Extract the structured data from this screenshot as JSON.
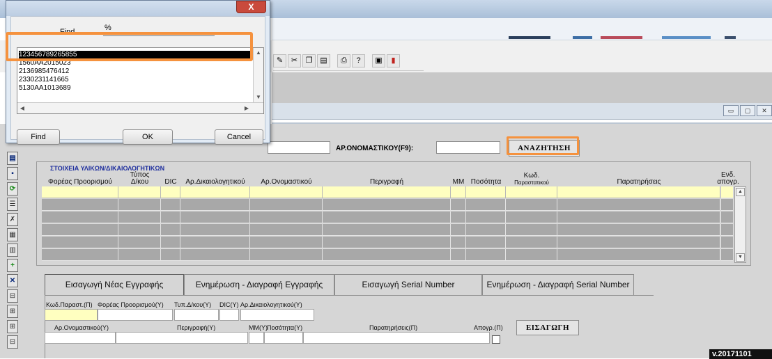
{
  "app": {
    "window_title": "",
    "version": "v.20171101"
  },
  "search": {
    "left_value": "",
    "label": "ΑΡ.ΟΝΟΜΑΣΤΙΚΟΥ(F9):",
    "value": "",
    "button_label": "ΑΝΑΖΗΤΗΣΗ"
  },
  "grid": {
    "section_title": "ΣΤΟΙΧΕΙΑ ΥΛΙΚΩΝ/ΔΙΚΑΙΟΛΟΓΗΤΙΚΩΝ",
    "columns": {
      "carrier": "Φορέας Προορισμού",
      "type_line1": "Τύπος",
      "type_line2": "Δ/κου",
      "dic": "DIC",
      "voucher_no": "Αρ.Δικαιολογητικού",
      "nominal_no": "Αρ.Ονομαστικού",
      "description": "Περιγραφή",
      "mm": "ΜΜ",
      "quantity": "Ποσότητα",
      "code_line1": "Κωδ.",
      "code_line2": "Παραστατικού",
      "notes": "Παρατηρήσεις",
      "archive_line1": "Ενδ.",
      "archive_line2": "απογρ."
    }
  },
  "tabs": [
    {
      "label": "Εισαγωγή Νέας Εγγραφής",
      "active": true
    },
    {
      "label": "Ενημέρωση - Διαγραφή Εγγραφής",
      "active": false
    },
    {
      "label": "Εισαγωγή Serial Number",
      "active": false
    },
    {
      "label": "Ενημέρωση - Διαγραφή Serial Number",
      "active": false
    }
  ],
  "new_record_form": {
    "code_label": "Κωδ.Παραστ.(Π)",
    "carrier_label": "Φορέας Προορισμού(Υ)",
    "type_label": "Τυπ.Δ/κου(Υ)",
    "dic_label": "DIC(Υ)",
    "voucher_label": "Αρ.Δικαιολογητικού(Υ)",
    "nominal_label": "Αρ.Ονομαστικού(Υ)",
    "description_label": "Περιγραφή(Υ)",
    "mm_label": "ΜΜ(Υ)",
    "quantity_label": "Ποσότητα(Υ)",
    "notes_label": "Παρατηρήσεις(Π)",
    "archive_label": "Απογρ.(Π)",
    "insert_button": "ΕΙΣΑΓΩΓΗ"
  },
  "lov_dialog": {
    "close_label": "X",
    "find_label": "Find",
    "find_value": "%",
    "items": [
      {
        "value": "123456789265855",
        "selected": true
      },
      {
        "value": "1560AA2015023",
        "selected": false
      },
      {
        "value": "2136985476412",
        "selected": false
      },
      {
        "value": "2330231141665",
        "selected": false
      },
      {
        "value": "5130AA1013689",
        "selected": false
      }
    ],
    "buttons": {
      "find": "Find",
      "ok": "OK",
      "cancel": "Cancel"
    }
  },
  "colors": {
    "highlight": "#f5923e",
    "section_title": "#1f2f9e",
    "required_field": "#ffffc0",
    "grid_cell": "#a8a8a8"
  }
}
